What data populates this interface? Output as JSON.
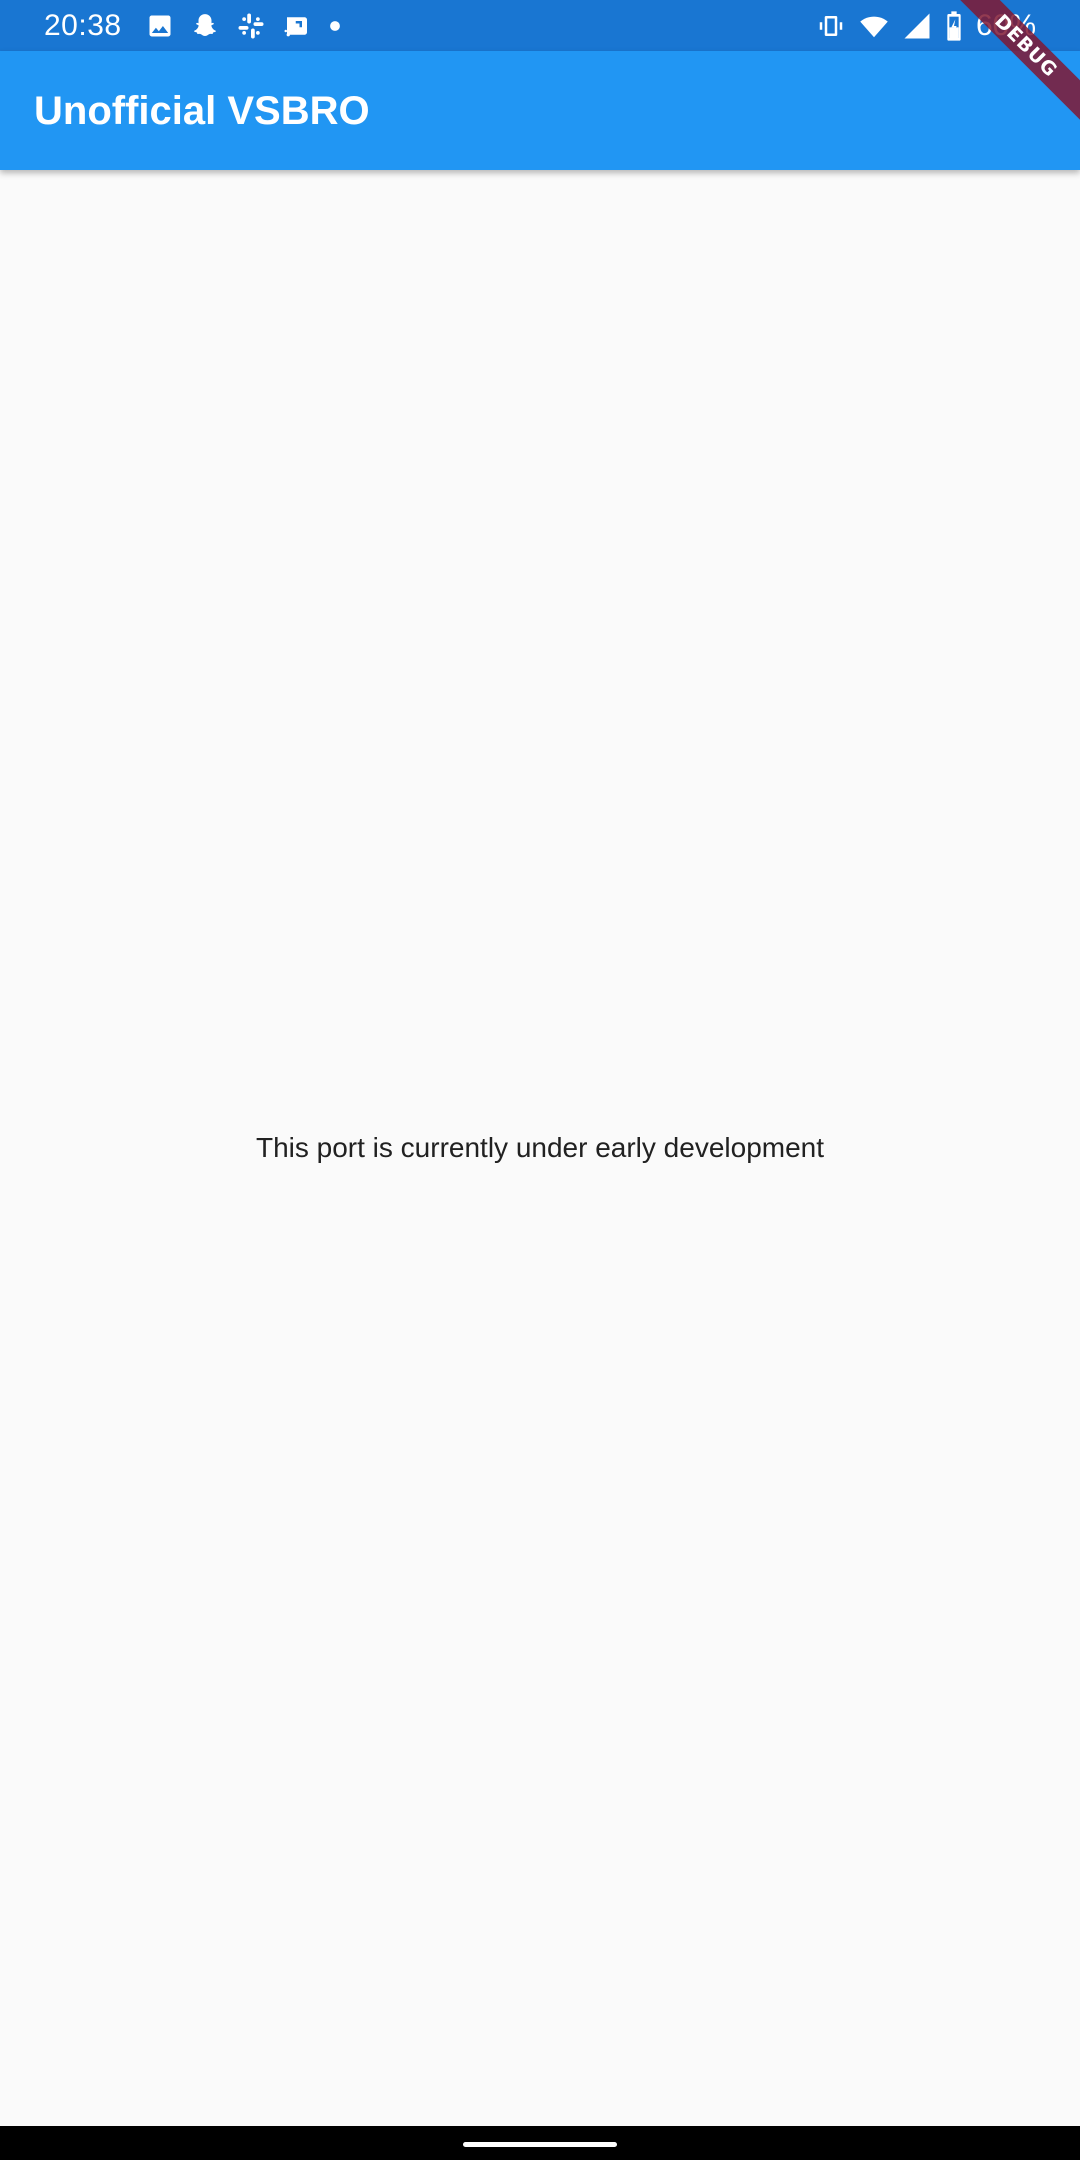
{
  "status_bar": {
    "time": "20:38",
    "battery_percent": "60%",
    "left_icons": [
      "gallery-icon",
      "snapchat-icon",
      "slack-icon",
      "screen-share-icon",
      "dot-icon"
    ],
    "right_icons": [
      "vibrate-icon",
      "wifi-icon",
      "signal-icon",
      "battery-charging-icon"
    ],
    "background_color": "#1976d2"
  },
  "app_bar": {
    "title": "Unofficial VSBRO",
    "background_color": "#2196f3"
  },
  "debug_banner": {
    "label": "DEBUG"
  },
  "main": {
    "message": "This port is currently under early development"
  },
  "nav_bar": {
    "background_color": "#000000"
  }
}
